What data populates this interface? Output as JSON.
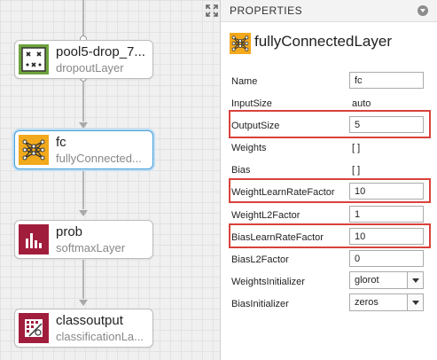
{
  "canvas": {
    "nodes": [
      {
        "name": "pool5-drop_7...",
        "type": "dropoutLayer",
        "icon": "dropout-layer-icon"
      },
      {
        "name": "fc",
        "type": "fullyConnected...",
        "icon": "fully-connected-layer-icon",
        "selected": true
      },
      {
        "name": "prob",
        "type": "softmaxLayer",
        "icon": "softmax-layer-icon"
      },
      {
        "name": "classoutput",
        "type": "classificationLa...",
        "icon": "classification-layer-icon"
      }
    ]
  },
  "properties": {
    "header": "PROPERTIES",
    "layer_title": "fullyConnectedLayer",
    "rows": {
      "name": {
        "label": "Name",
        "value": "fc"
      },
      "input_size": {
        "label": "InputSize",
        "value": "auto"
      },
      "output_size": {
        "label": "OutputSize",
        "value": "5"
      },
      "weights": {
        "label": "Weights",
        "value": "[ ]"
      },
      "bias": {
        "label": "Bias",
        "value": "[ ]"
      },
      "weight_lr": {
        "label": "WeightLearnRateFactor",
        "value": "10"
      },
      "weight_l2": {
        "label": "WeightL2Factor",
        "value": "1"
      },
      "bias_lr": {
        "label": "BiasLearnRateFactor",
        "value": "10"
      },
      "bias_l2": {
        "label": "BiasL2Factor",
        "value": "0"
      },
      "weights_init": {
        "label": "WeightsInitializer",
        "value": "glorot"
      },
      "bias_init": {
        "label": "BiasInitializer",
        "value": "zeros"
      }
    }
  },
  "colors": {
    "highlight": "#d9423c",
    "dropout_icon": "#6ea33d",
    "fc_icon": "#f2a91c",
    "softmax_icon": "#a11d3c",
    "selected_border": "#4a9fd8"
  }
}
